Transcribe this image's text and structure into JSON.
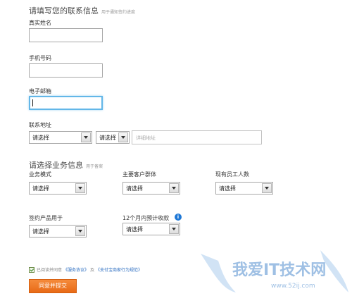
{
  "contact": {
    "title": "请填写您的联系信息",
    "hint": "用于通知签约进度",
    "name_label": "真实姓名",
    "phone_label": "手机号码",
    "email_label": "电子邮箱",
    "address_label": "联系地址",
    "province_value": "请选择",
    "city_value": "请选择",
    "detail_placeholder": "详细地址"
  },
  "business": {
    "title": "请选择业务信息",
    "hint": "用于备案",
    "mode_label": "业务模式",
    "mode_value": "请选择",
    "customer_label": "主要客户群体",
    "customer_value": "请选择",
    "staff_label": "现有员工人数",
    "staff_value": "请选择",
    "product_label": "签约产品用于",
    "product_value": "请选择",
    "revenue_label": "12个月内预计收款",
    "revenue_value": "请选择",
    "info_icon_glyph": "i"
  },
  "agreement": {
    "prefix": "已阅读并同意",
    "link1": "《服务协议》",
    "and": "及",
    "link2": "《支付宝商家行为规范》"
  },
  "submit_label": "同意并提交",
  "watermark": {
    "text": "我爱IT技术网",
    "sub": "www.52ij.com"
  }
}
